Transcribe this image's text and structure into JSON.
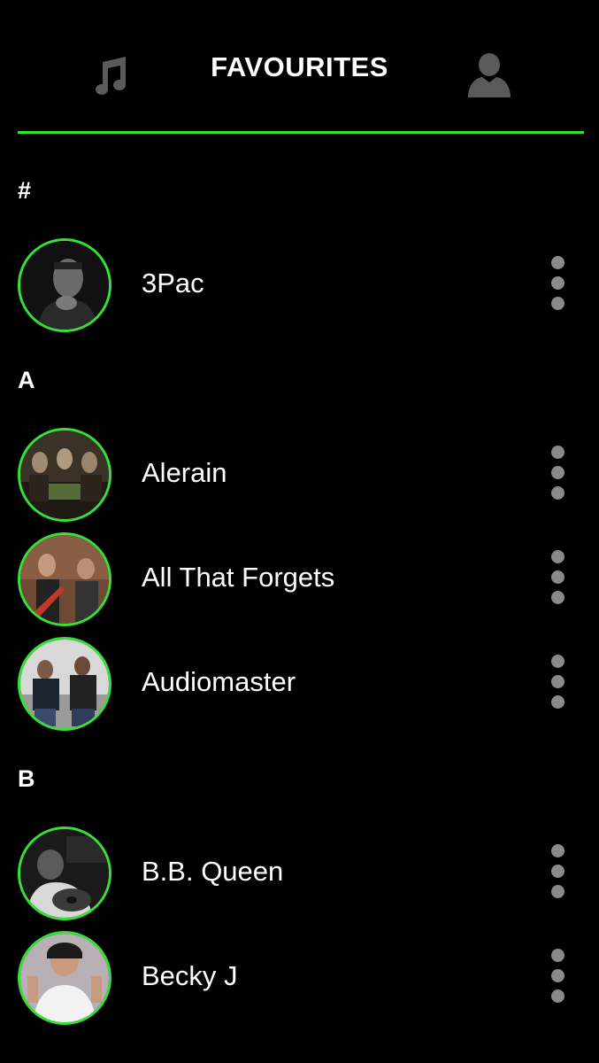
{
  "header": {
    "title": "FAVOURITES",
    "left_icon": "music-note-icon",
    "right_icon": "user-profile-icon",
    "accent_color": "#33e233"
  },
  "sections": [
    {
      "letter": "#",
      "items": [
        {
          "name": "3Pac",
          "avatar": "artist-photo"
        }
      ]
    },
    {
      "letter": "A",
      "items": [
        {
          "name": "Alerain",
          "avatar": "band-photo"
        },
        {
          "name": "All That Forgets",
          "avatar": "band-photo"
        },
        {
          "name": "Audiomaster",
          "avatar": "band-photo"
        }
      ]
    },
    {
      "letter": "B",
      "items": [
        {
          "name": "B.B. Queen",
          "avatar": "artist-photo"
        },
        {
          "name": "Becky J",
          "avatar": "artist-photo"
        }
      ]
    }
  ],
  "colors": {
    "background": "#000000",
    "accent": "#33e233",
    "more_dots": "#8a8a8a"
  }
}
